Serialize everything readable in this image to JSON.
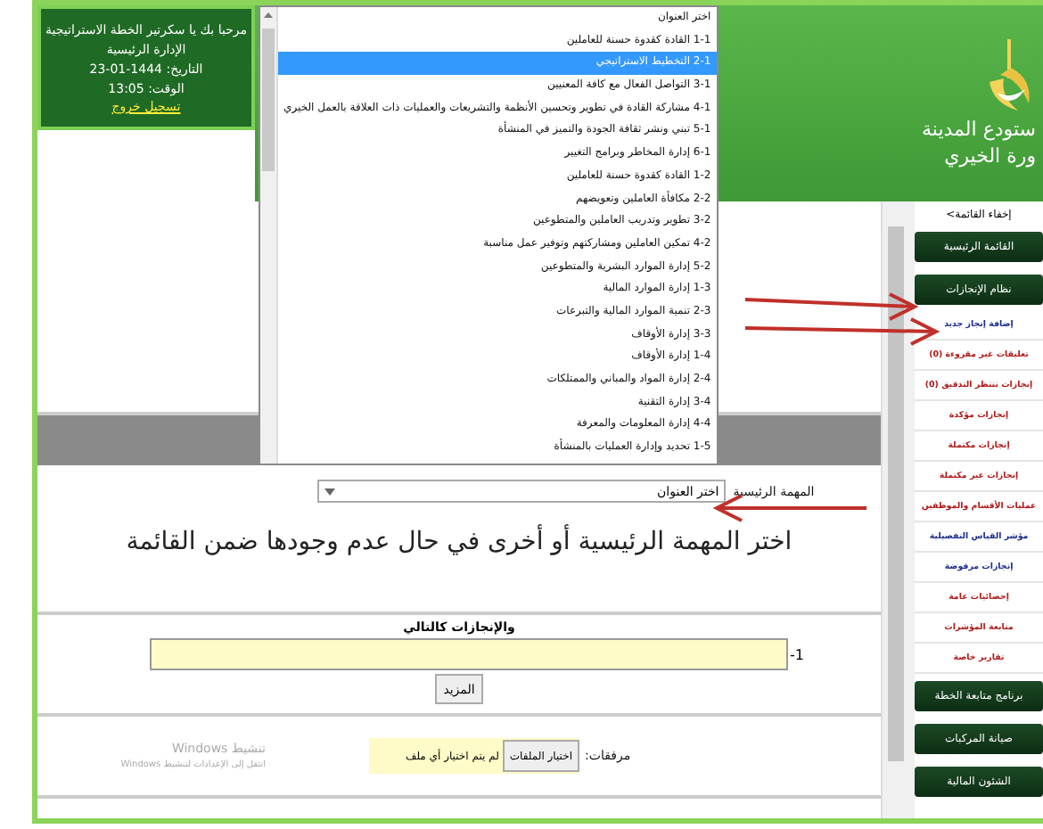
{
  "header": {
    "welcome_lines": [
      "مرحبا بك يا سكرتير الخطة الاستراتيجية",
      "الإدارة الرئيسية",
      "التاريخ: 1444-01-23",
      "الوقت: 13:05"
    ],
    "logout": "تسجيل خروج",
    "logo_lines": [
      "ستودع المدينة",
      "ورة الخيري"
    ]
  },
  "dropdown": {
    "options": [
      {
        "label": "اختر العنوان",
        "selected": false
      },
      {
        "label": "1-1 القادة كقدوة حسنة للعاملين",
        "selected": false
      },
      {
        "label": "2-1 التخطيط الاستراتيجي",
        "selected": true
      },
      {
        "label": "3-1 التواصل الفعال مع كافة المعنيين",
        "selected": false
      },
      {
        "label": "4-1 مشاركة القادة في تطوير وتحسين الأنظمة والتشريعات والعمليات ذات العلاقة بالعمل الخيري",
        "selected": false
      },
      {
        "label": "5-1 تبني ونشر ثقافة الجودة والتميز في المنشأة",
        "selected": false
      },
      {
        "label": "6-1 إدارة المخاطر وبرامج التغيير",
        "selected": false
      },
      {
        "label": "1-2 القادة كقدوة حسنة للعاملين",
        "selected": false
      },
      {
        "label": "2-2 مكافأة العاملين وتعويضهم",
        "selected": false
      },
      {
        "label": "3-2 تطوير وتدريب العاملين والمتطوعين",
        "selected": false
      },
      {
        "label": "4-2 تمكين العاملين ومشاركتهم وتوفير عمل مناسبة",
        "selected": false
      },
      {
        "label": "5-2 إدارة الموارد البشرية والمتطوعين",
        "selected": false
      },
      {
        "label": "1-3 إدارة الموارد المالية",
        "selected": false
      },
      {
        "label": "2-3 تنمية الموارد المالية والتبرعات",
        "selected": false
      },
      {
        "label": "3-3 إدارة الأوقاف",
        "selected": false
      },
      {
        "label": "1-4 إدارة الأوقاف",
        "selected": false
      },
      {
        "label": "2-4 إدارة المواد والمباني والممتلكات",
        "selected": false
      },
      {
        "label": "3-4 إدارة التقنية",
        "selected": false
      },
      {
        "label": "4-4 إدارة المعلومات والمعرفة",
        "selected": false
      },
      {
        "label": "1-5 تحديد وإدارة العمليات بالمنشأة",
        "selected": false
      }
    ]
  },
  "task_select": {
    "label": "المهمة الرئيسية",
    "value": "اختر العنوان"
  },
  "heading": "اختر المهمة الرئيسية أو أخرى في حال عدم وجودها ضمن القائمة",
  "achievements": {
    "label": "والإنجازات كالتالي",
    "rows": [
      {
        "index": "1-"
      }
    ],
    "more_button": "المزيد"
  },
  "attachments": {
    "label": "مرفقات:",
    "button": "اختيار الملفات",
    "status": "لم يتم اختيار أي ملف"
  },
  "windows_notice": {
    "title": "تنشيط Windows",
    "hint": "انتقل إلى الإعدادات لتنشيط Windows"
  },
  "sidebar": {
    "toggle": "إخفاء القائمة>",
    "items": [
      {
        "kind": "section",
        "label": "القائمة الرئيسية"
      },
      {
        "kind": "section",
        "label": "نظام الإنجازات"
      },
      {
        "kind": "link",
        "label": "إضافة إنجاز جديد",
        "color": "#1a2a8c"
      },
      {
        "kind": "link",
        "label": "تعليقات غير مقروءة (0)",
        "color": "#b01818"
      },
      {
        "kind": "link",
        "label": "إنجازات تنتظر التدقيق (0)",
        "color": "#b01818"
      },
      {
        "kind": "link",
        "label": "إنجازات مؤكدة",
        "color": "#b01818"
      },
      {
        "kind": "link",
        "label": "إنجازات مكتملة",
        "color": "#b01818"
      },
      {
        "kind": "link",
        "label": "إنجازات غير مكتملة",
        "color": "#b01818"
      },
      {
        "kind": "link",
        "label": "عمليات الأقسام والموظفين",
        "color": "#b01818"
      },
      {
        "kind": "link",
        "label": "مؤشر القياس التفصيلية",
        "color": "#1a2a8c"
      },
      {
        "kind": "link",
        "label": "إنجازات مرفوضة",
        "color": "#1a2a8c"
      },
      {
        "kind": "link",
        "label": "إحصائيات عامة",
        "color": "#b01818"
      },
      {
        "kind": "link",
        "label": "متابعة المؤشرات",
        "color": "#b01818"
      },
      {
        "kind": "link",
        "label": "تقارير خاصة",
        "color": "#b01818"
      },
      {
        "kind": "section",
        "label": "برنامج متابعة الخطة"
      },
      {
        "kind": "section",
        "label": "صيانة المركبات"
      },
      {
        "kind": "section",
        "label": "الشئون المالية"
      }
    ]
  }
}
